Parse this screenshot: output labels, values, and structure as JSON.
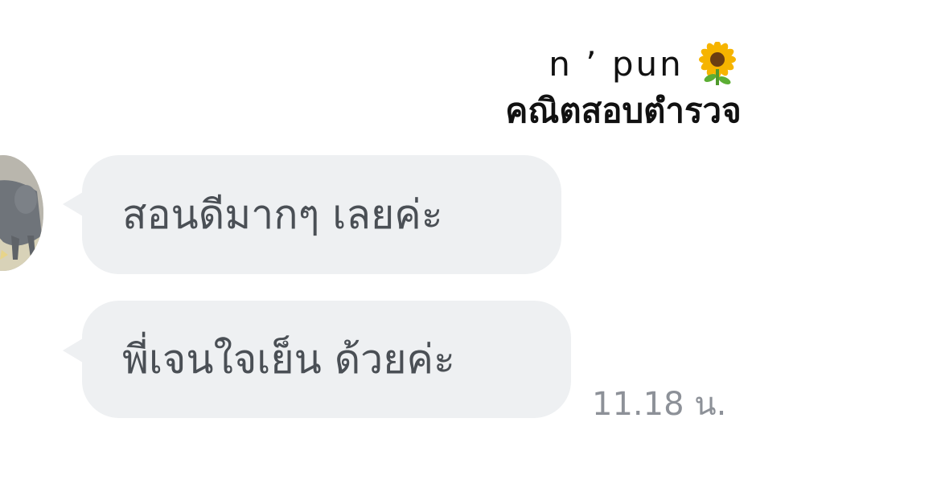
{
  "caption": {
    "name": "n ’ pun",
    "emoji": "sunflower-icon",
    "subtitle": "คณิตสอบตำรวจ"
  },
  "chat": {
    "avatar": "dog-avatar",
    "messages": [
      {
        "text": "สอนดีมากๆ เลยค่ะ"
      },
      {
        "text": "พี่เจนใจเย็น ด้วยค่ะ"
      }
    ],
    "timestamp": "11.18 น."
  },
  "colors": {
    "bubble": "#eef0f2",
    "bubble_text": "#4a4f55",
    "timestamp": "#8d9198",
    "background": "#ffffff"
  }
}
